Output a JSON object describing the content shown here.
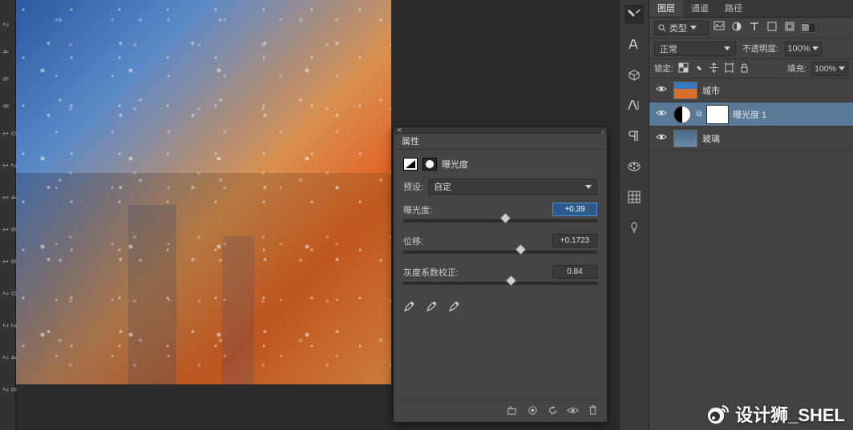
{
  "ruler_marks": [
    "2",
    "4",
    "6",
    "8",
    "1\n0",
    "1\n2",
    "1\n4",
    "1\n6",
    "1\n8",
    "2\n0",
    "2\n2",
    "2\n4",
    "2\n6"
  ],
  "panel": {
    "title": "属性",
    "adjustment_label": "曝光度",
    "preset_label": "预设:",
    "preset_value": "自定",
    "sliders": {
      "exposure": {
        "label": "曝光度:",
        "value": "+0.39",
        "pos": 52
      },
      "offset": {
        "label": "位移:",
        "value": "+0.1723",
        "pos": 60
      },
      "gamma": {
        "label": "灰度系数校正:",
        "value": "0.84",
        "pos": 55
      }
    }
  },
  "layers_panel": {
    "tabs": [
      "图层",
      "通道",
      "路径"
    ],
    "search_label": "类型",
    "blend_mode": "正常",
    "opacity_label": "不透明度:",
    "opacity_value": "100%",
    "lock_label": "锁定:",
    "fill_label": "填充:",
    "fill_value": "100%",
    "layers": [
      {
        "name": "城市"
      },
      {
        "name": "曝光度 1"
      },
      {
        "name": "玻璃"
      }
    ]
  },
  "watermark": "设计狮_SHEL"
}
